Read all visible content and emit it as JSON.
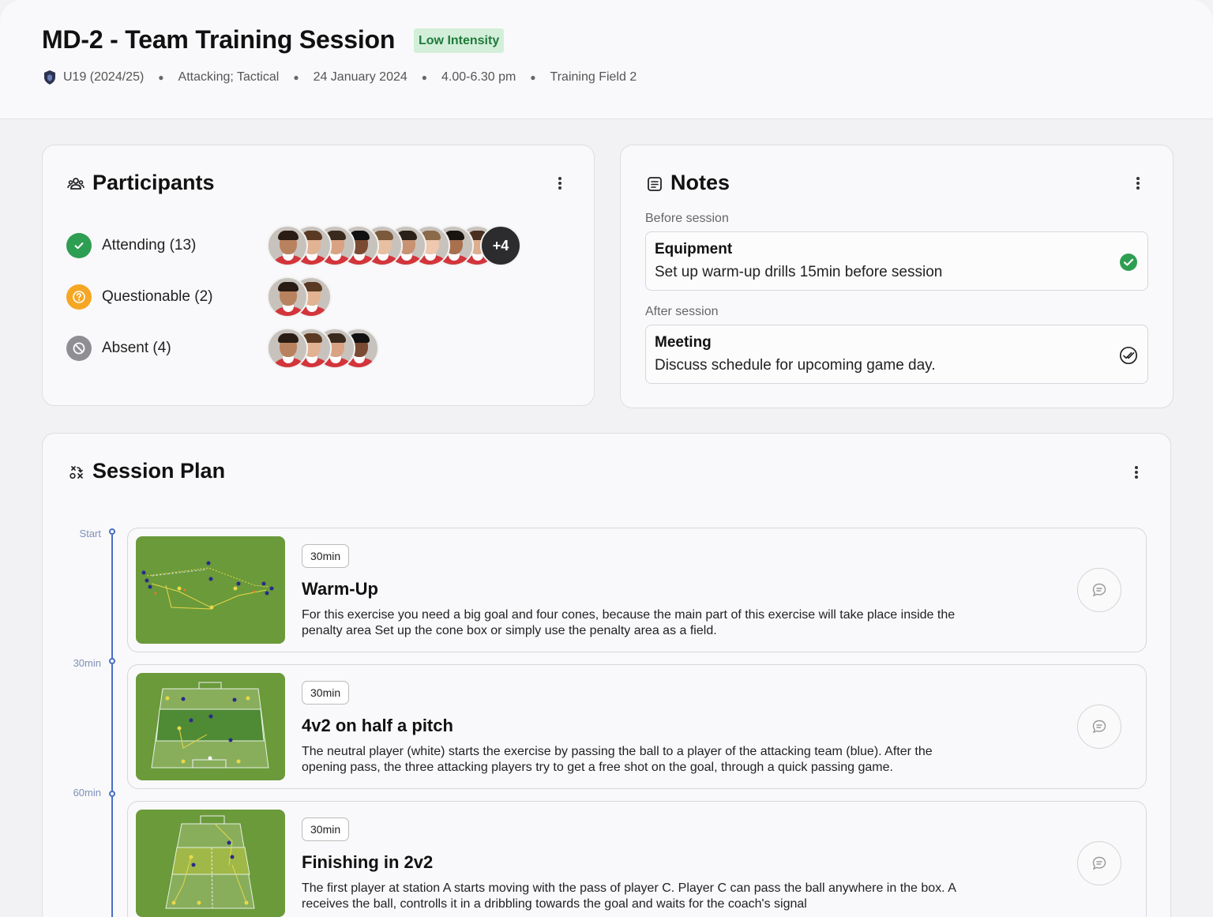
{
  "header": {
    "title": "MD-2 - Team Training Session",
    "intensity_badge": "Low Intensity",
    "meta": {
      "team": "U19 (2024/25)",
      "focus": "Attacking; Tactical",
      "date": "24 January 2024",
      "time": "4.00-6.30 pm",
      "location": "Training Field 2"
    }
  },
  "participants": {
    "title": "Participants",
    "groups": [
      {
        "label": "Attending (13)",
        "status": "attending",
        "color": "#2e9e52",
        "shown": 9,
        "overflow": "+4"
      },
      {
        "label": "Questionable (2)",
        "status": "questionable",
        "color": "#f5a623",
        "shown": 2
      },
      {
        "label": "Absent (4)",
        "status": "absent",
        "color": "#8e8e93",
        "shown": 4
      }
    ]
  },
  "notes": {
    "title": "Notes",
    "before_label": "Before session",
    "after_label": "After session",
    "items": [
      {
        "title": "Equipment",
        "text": "Set up warm-up drills 15min before session",
        "done": true
      },
      {
        "title": "Meeting",
        "text": "Discuss schedule for upcoming game day.",
        "done": false
      }
    ]
  },
  "session_plan": {
    "title": "Session Plan",
    "timeline_labels": [
      "Start",
      "30min",
      "60min"
    ],
    "drills": [
      {
        "duration": "30min",
        "title": "Warm-Up",
        "description": "For this exercise you need a big goal and four cones, because the main part of this exercise will take place inside the penalty area Set up the cone box or simply use the penalty area as a field."
      },
      {
        "duration": "30min",
        "title": "4v2 on half a pitch",
        "description": "The neutral player (white) starts the exercise by passing the ball to a player of the attacking team (blue). After the opening pass, the three attacking players try to get a free shot on the goal, through a quick passing game."
      },
      {
        "duration": "30min",
        "title": "Finishing in 2v2",
        "description": "The first player at station A starts moving with the pass of player C. Player C can pass the ball anywhere in the box. A receives the ball, controlls it in a dribbling towards the goal and waits for the coach's signal"
      }
    ]
  },
  "colors": {
    "accent": "#4a6fc4",
    "badge_bg": "#d3efd9",
    "badge_text": "#1f7a3b",
    "pitch": "#6a9a3a"
  }
}
